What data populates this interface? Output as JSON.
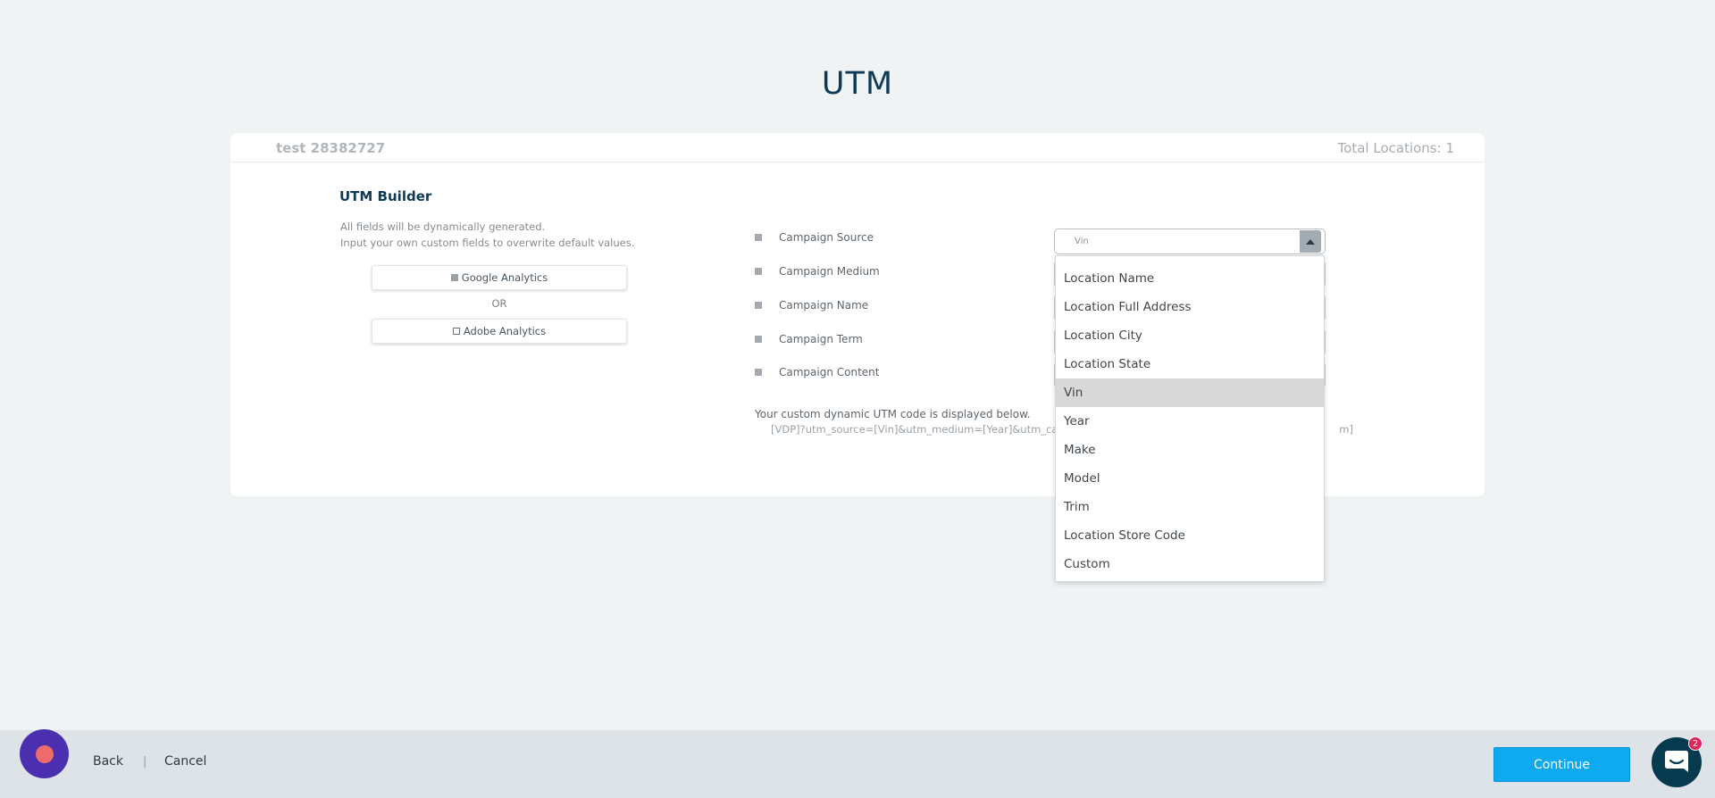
{
  "page": {
    "title": "UTM"
  },
  "card": {
    "account_name": "test 28382727",
    "total_locations": "Total Locations: 1"
  },
  "builder": {
    "title": "UTM Builder",
    "desc_line1": "All fields will be dynamically generated.",
    "desc_line2": "Input your own custom fields to overwrite default values.",
    "google_label": "Google Analytics",
    "or_label": "OR",
    "adobe_label": "Adobe Analytics"
  },
  "fields": [
    {
      "label": "Campaign Source",
      "value": "Vin"
    },
    {
      "label": "Campaign Medium"
    },
    {
      "label": "Campaign Name"
    },
    {
      "label": "Campaign Term"
    },
    {
      "label": "Campaign Content"
    }
  ],
  "custom_code": {
    "label": "Your custom dynamic UTM code is displayed below.",
    "code_visible_start": "[VDP]?utm_source=[Vin]&utm_medium=[Year]&utm_can",
    "code_visible_end": "m]"
  },
  "dropdown": {
    "selected": "Vin",
    "options": [
      "Location Name",
      "Location Full Address",
      "Location City",
      "Location State",
      "Vin",
      "Year",
      "Make",
      "Model",
      "Trim",
      "Location Store Code",
      "Custom"
    ]
  },
  "footer": {
    "back_label": "Back",
    "separator": "|",
    "cancel_label": "Cancel",
    "continue_label": "Continue",
    "chat_badge_count": "2"
  },
  "colors": {
    "accent": "#0fa9f0",
    "title": "#0e3a55",
    "bot": "#4b2fb1",
    "badge": "#e0235a"
  }
}
